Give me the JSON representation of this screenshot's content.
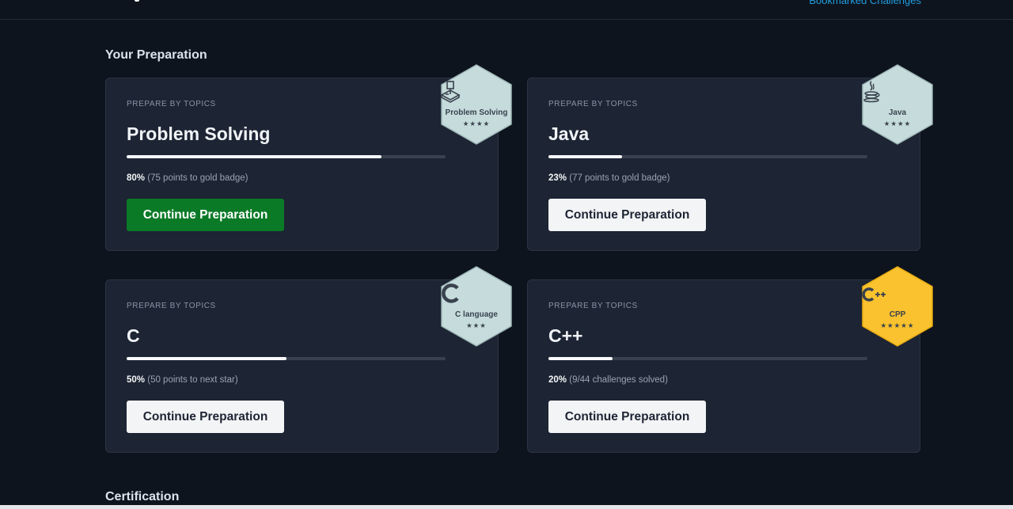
{
  "header": {
    "bookmarks_label": "Bookmarked Challenges"
  },
  "sections": {
    "preparation_title": "Your Preparation",
    "certification_title": "Certification"
  },
  "cards": [
    {
      "kicker": "PREPARE BY TOPICS",
      "title": "Problem Solving",
      "percent_label": "80%",
      "progress": 0.8,
      "detail": "(75 points to gold badge)",
      "button_label": "Continue Preparation",
      "button_primary": true,
      "badge": {
        "label": "Problem Solving",
        "stars": "★★★★",
        "icon": "problem-solving-icon",
        "color": "#c6dcdc"
      }
    },
    {
      "kicker": "PREPARE BY TOPICS",
      "title": "Java",
      "percent_label": "23%",
      "progress": 0.23,
      "detail": "(77 points to gold badge)",
      "button_label": "Continue Preparation",
      "button_primary": false,
      "badge": {
        "label": "Java",
        "stars": "★★★★",
        "icon": "java-icon",
        "color": "#c6dcdc"
      }
    },
    {
      "kicker": "PREPARE BY TOPICS",
      "title": "C",
      "percent_label": "50%",
      "progress": 0.5,
      "detail": "(50 points to next star)",
      "button_label": "Continue Preparation",
      "button_primary": false,
      "badge": {
        "label": "C language",
        "stars": "★★★",
        "icon": "c-language-icon",
        "color": "#c6dcdc"
      }
    },
    {
      "kicker": "PREPARE BY TOPICS",
      "title": "C++",
      "percent_label": "20%",
      "progress": 0.2,
      "detail": "(9/44 challenges solved)",
      "button_label": "Continue Preparation",
      "button_primary": false,
      "badge": {
        "label": "CPP",
        "stars": "★★★★★",
        "icon": "cpp-icon",
        "color": "#f9c22e"
      }
    }
  ],
  "colors": {
    "background": "#0e141e",
    "card": "#1d2433",
    "primary_button": "#0b7a27",
    "silver_badge": "#c6dcdc",
    "gold_badge": "#f9c22e"
  }
}
